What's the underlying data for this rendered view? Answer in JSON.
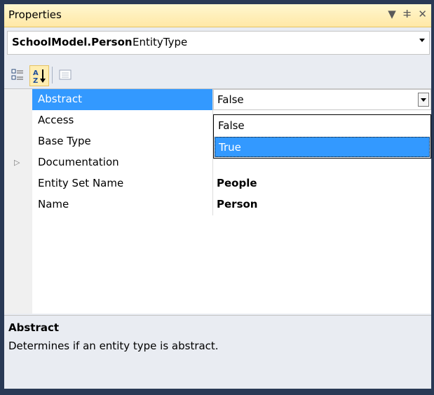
{
  "window": {
    "title": "Properties",
    "buttons": [
      "▼",
      "ⵐ",
      "✕"
    ]
  },
  "object_selector": {
    "name": "SchoolModel.Person",
    "type": "EntityType"
  },
  "toolbar": {
    "buttons": [
      "categorized-icon",
      "alphabetical-icon",
      "property-pages-icon"
    ]
  },
  "properties": [
    {
      "name": "Abstract",
      "value": "False",
      "bold": false,
      "selected": true,
      "expandable": false
    },
    {
      "name": "Access",
      "value": "",
      "bold": false,
      "selected": false,
      "expandable": false
    },
    {
      "name": "Base Type",
      "value": "",
      "bold": false,
      "selected": false,
      "expandable": false
    },
    {
      "name": "Documentation",
      "value": "",
      "bold": false,
      "selected": false,
      "expandable": true
    },
    {
      "name": "Entity Set Name",
      "value": "People",
      "bold": true,
      "selected": false,
      "expandable": false
    },
    {
      "name": "Name",
      "value": "Person",
      "bold": true,
      "selected": false,
      "expandable": false
    }
  ],
  "dropdown": {
    "options": [
      "False",
      "True"
    ],
    "highlighted": "True"
  },
  "description": {
    "title": "Abstract",
    "text": "Determines if an entity type is abstract."
  },
  "colors": {
    "selection": "#3399ff",
    "frame": "#293955",
    "title_bg": "#ffedb0"
  }
}
